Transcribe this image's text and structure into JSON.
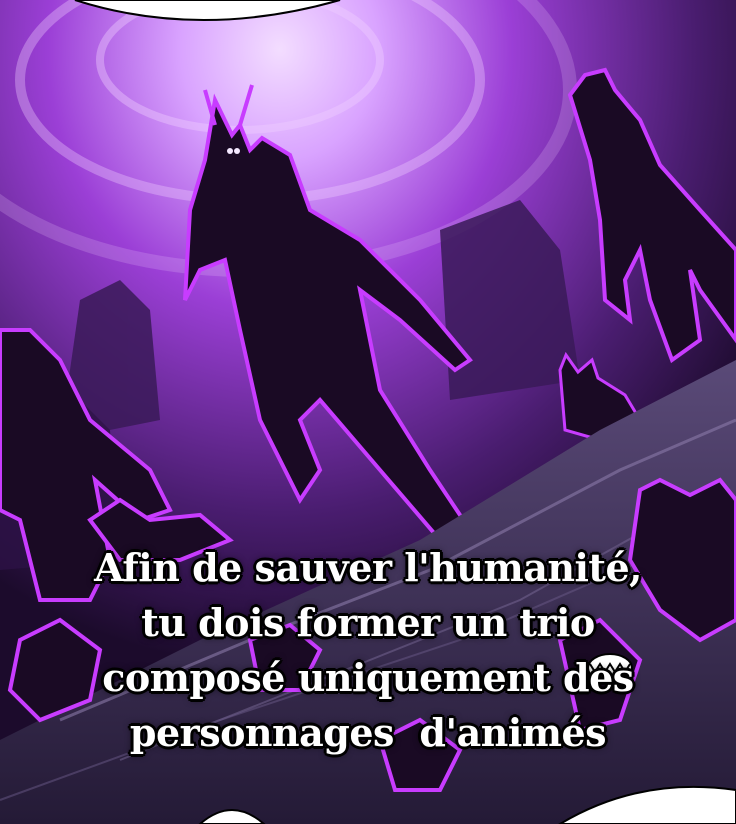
{
  "caption": {
    "lines": [
      "Afin de sauver l'humanité,",
      "tu dois former un trio",
      "composé uniquement des",
      "personnages  d'animés"
    ],
    "text_color": "#ffffff",
    "outline_color": "#000000"
  },
  "scene": {
    "palette": {
      "sky_glow": "#d9a3ff",
      "sky_mid": "#9b3fd6",
      "sky_dark": "#2a0f45",
      "silhouette": "#1a0a24",
      "outline_glow": "#c83cff",
      "rocks": "#3b2e52",
      "speech_bubble": "#ffffff"
    }
  }
}
